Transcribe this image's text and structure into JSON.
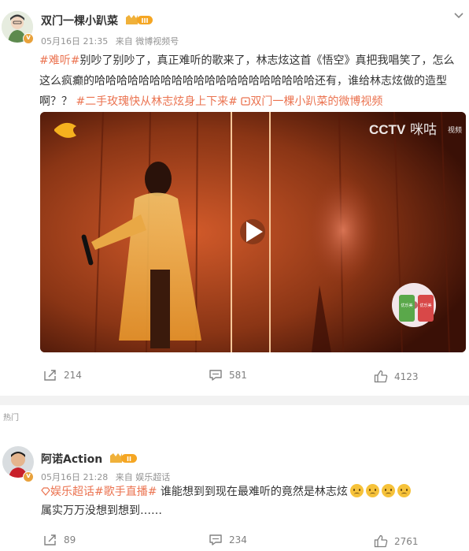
{
  "post": {
    "username": "双门一棵小趴菜",
    "level_badge": "III",
    "time": "05月16日 21:35",
    "source": "来自 微博视频号",
    "text_tag": "#难听#",
    "text_main": "别吵了别吵了，真正难听的歌来了，林志炫这首《悟空》真把我唱笑了，怎么这么疯癫的哈哈哈哈哈哈哈哈哈哈哈哈哈哈哈哈哈哈哈哈还有，谁给林志炫做的造型啊？？",
    "text_topic": "#二手玫瑰快从林志炫身上下来#",
    "text_video_link": "双门一棵小趴菜的微博视频",
    "video": {
      "watermark_right": "咪咕",
      "watermark_right_sub": "视频",
      "watermark_cctv": "CCTV",
      "promo_text_1": "优乐美",
      "promo_text_2": "优乐美"
    },
    "actions": {
      "repost": "214",
      "comment": "581",
      "like": "4123"
    }
  },
  "section_label": "热门",
  "comment": {
    "username": "阿诺Action",
    "level_badge": "II",
    "time": "05月16日 21:28",
    "source": "来自 娱乐超话",
    "topic_1": "娱乐超话",
    "topic_2": "#歌手直播#",
    "text_1": "谁能想到到现在最难听的竟然是林志炫",
    "text_2": "属实万万没想到想到……",
    "actions": {
      "repost": "89",
      "comment": "234",
      "like": "2761"
    }
  },
  "colors": {
    "link": "#eb7350",
    "meta": "#939393",
    "badge": "#e8a13b"
  }
}
